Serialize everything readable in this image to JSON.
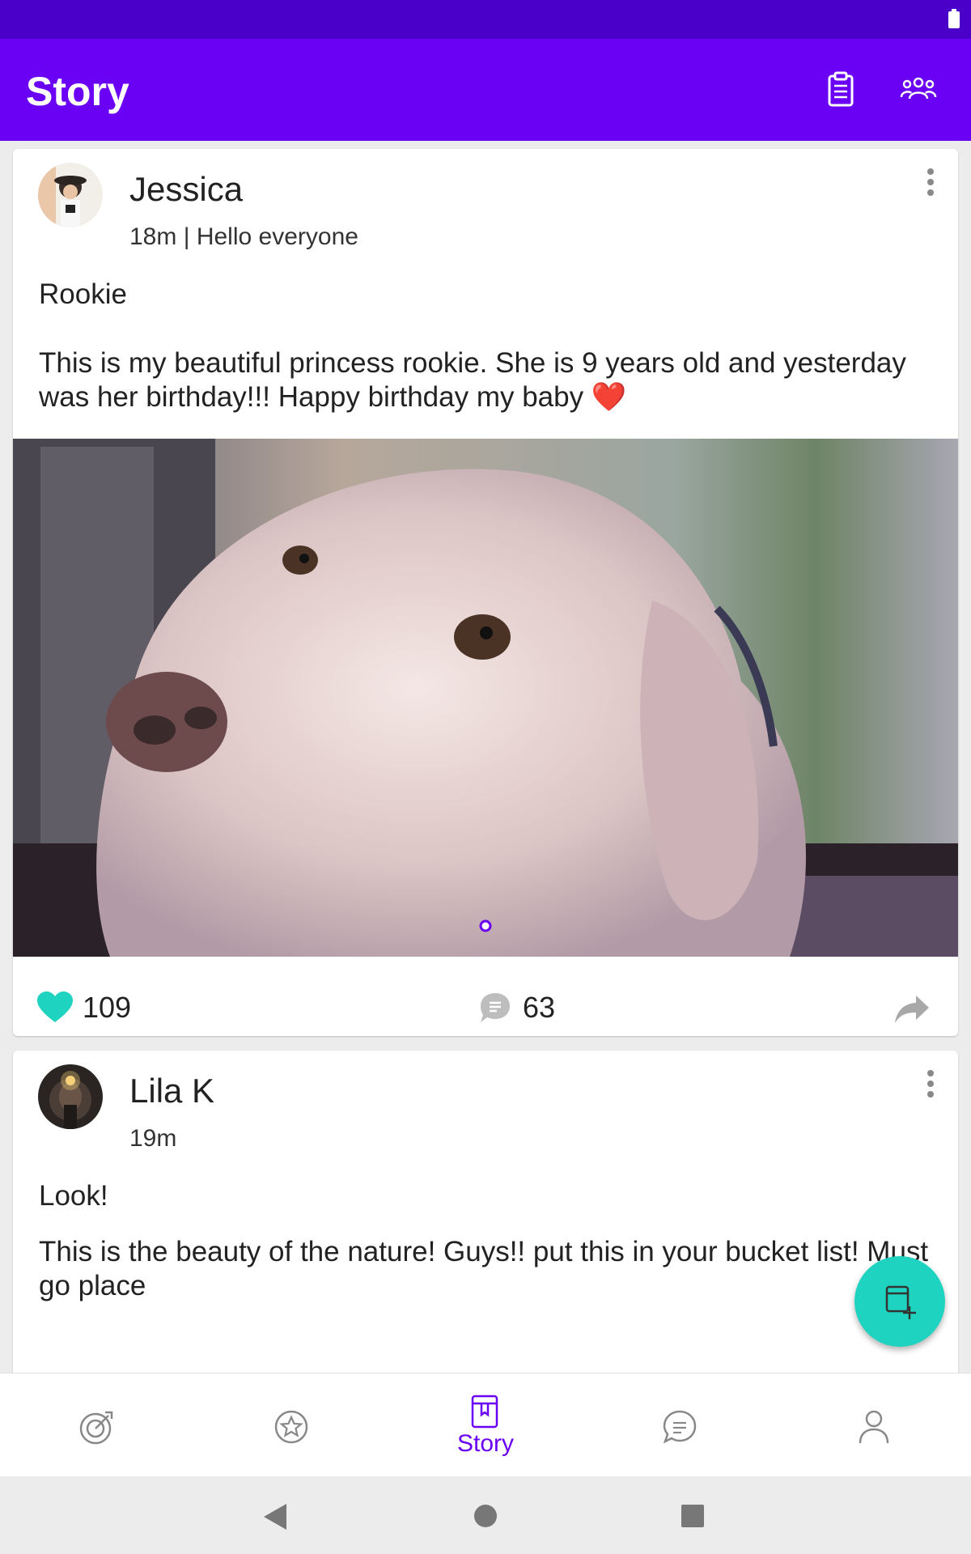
{
  "app_bar": {
    "title": "Story",
    "icons": [
      "clipboard-icon",
      "group-icon"
    ]
  },
  "posts": [
    {
      "author": "Jessica",
      "meta": "18m | Hello everyone",
      "title": "Rookie",
      "body": "This is my beautiful princess rookie. She is 9 years old and yesterday was her birthday!!! Happy birthday my baby ❤️",
      "likes": "109",
      "comments": "63"
    },
    {
      "author": "Lila K",
      "meta": "19m",
      "title": "Look!",
      "body": "This is the beauty of the nature! Guys!! put this in your bucket list! Must go place"
    }
  ],
  "bottom_nav": {
    "items": [
      "target-icon",
      "star-icon",
      "story-icon",
      "chat-icon",
      "profile-icon"
    ],
    "active_label": "Story"
  },
  "colors": {
    "primary": "#6a00f4",
    "status_bar": "#4a00c9",
    "accent": "#1ed4c0"
  }
}
